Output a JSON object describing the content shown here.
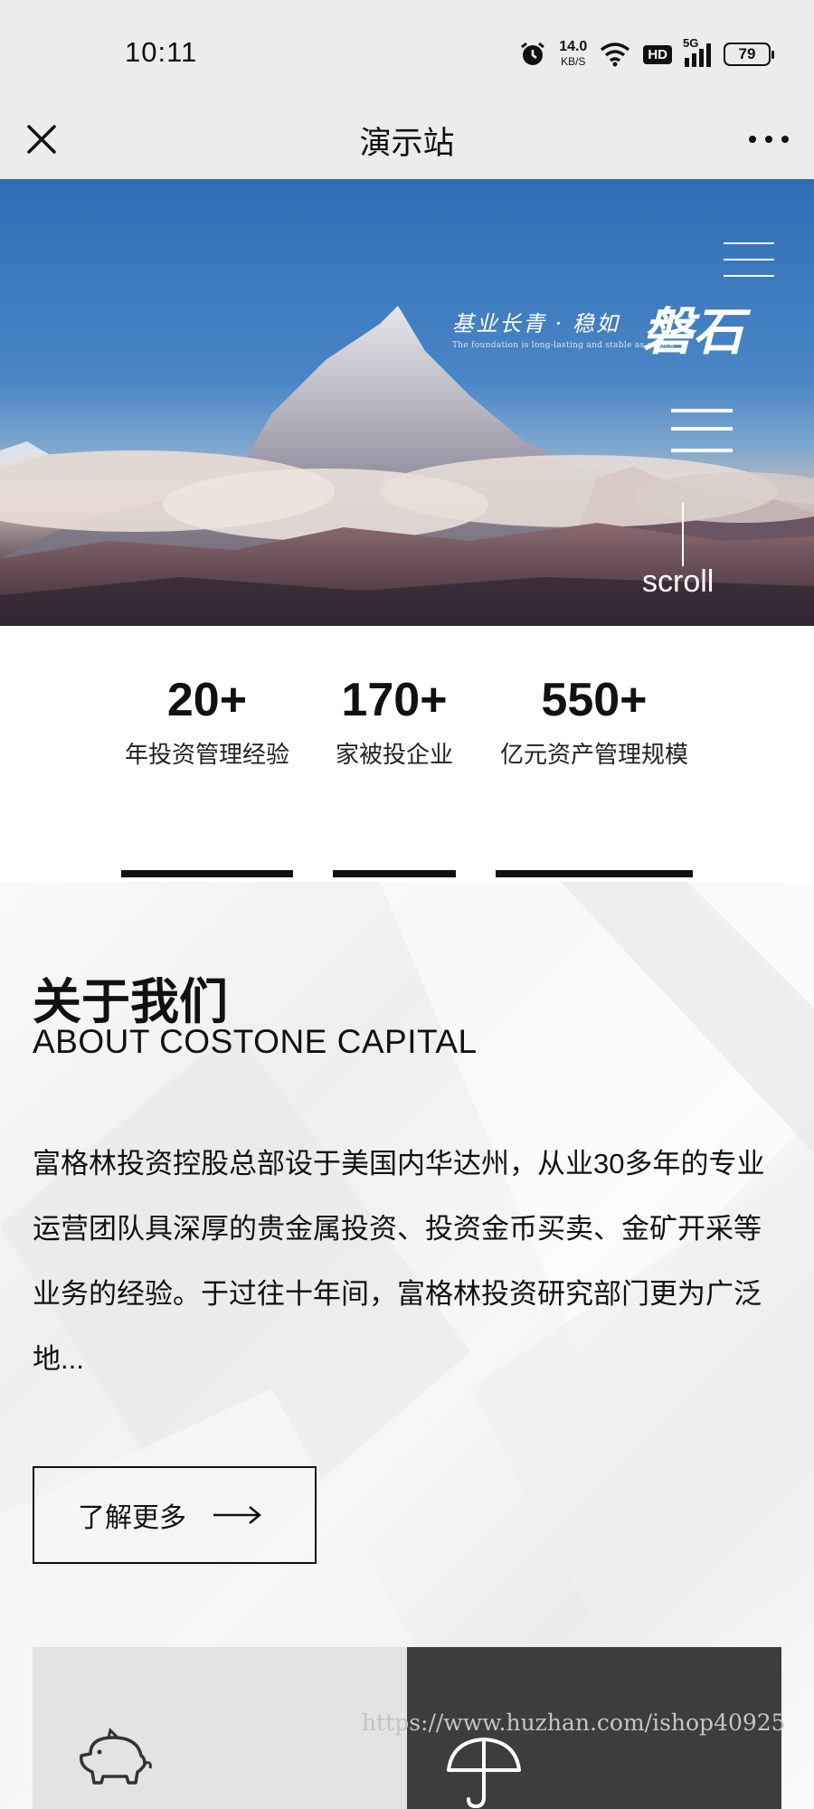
{
  "status_bar": {
    "time": "10:11",
    "net_speed": "14.0",
    "net_unit": "KB/S",
    "hd": "HD",
    "signal": "5G",
    "battery": "79"
  },
  "nav": {
    "title": "演示站",
    "close_icon": "close-icon",
    "more_icon": "more-icon"
  },
  "hero": {
    "slogan_line": "基业长青 · 稳如",
    "slogan_big": "磐石",
    "slogan_en": "The foundation is long-lasting and stable as a rock",
    "scroll_label": "scroll"
  },
  "stats": [
    {
      "value": "20+",
      "label": "年投资管理经验"
    },
    {
      "value": "170+",
      "label": "家被投企业"
    },
    {
      "value": "550+",
      "label": "亿元资产管理规模"
    }
  ],
  "about": {
    "title": "关于我们",
    "subtitle": "ABOUT COSTONE CAPITAL",
    "body": "富格林投资控股总部设于美国内华达州，从业30多年的专业运营团队具深厚的贵金属投资、投资金币买卖、金矿开采等业务的经验。于过往十年间，富格林投资研究部门更为广泛地...",
    "more_label": "了解更多"
  },
  "watermark": "https://www.huzhan.com/ishop40925",
  "colors": {
    "bar_bg": "#ececec",
    "accent": "#111111",
    "tile_light": "#e3e3e4",
    "tile_dark": "#3d3d3d"
  }
}
